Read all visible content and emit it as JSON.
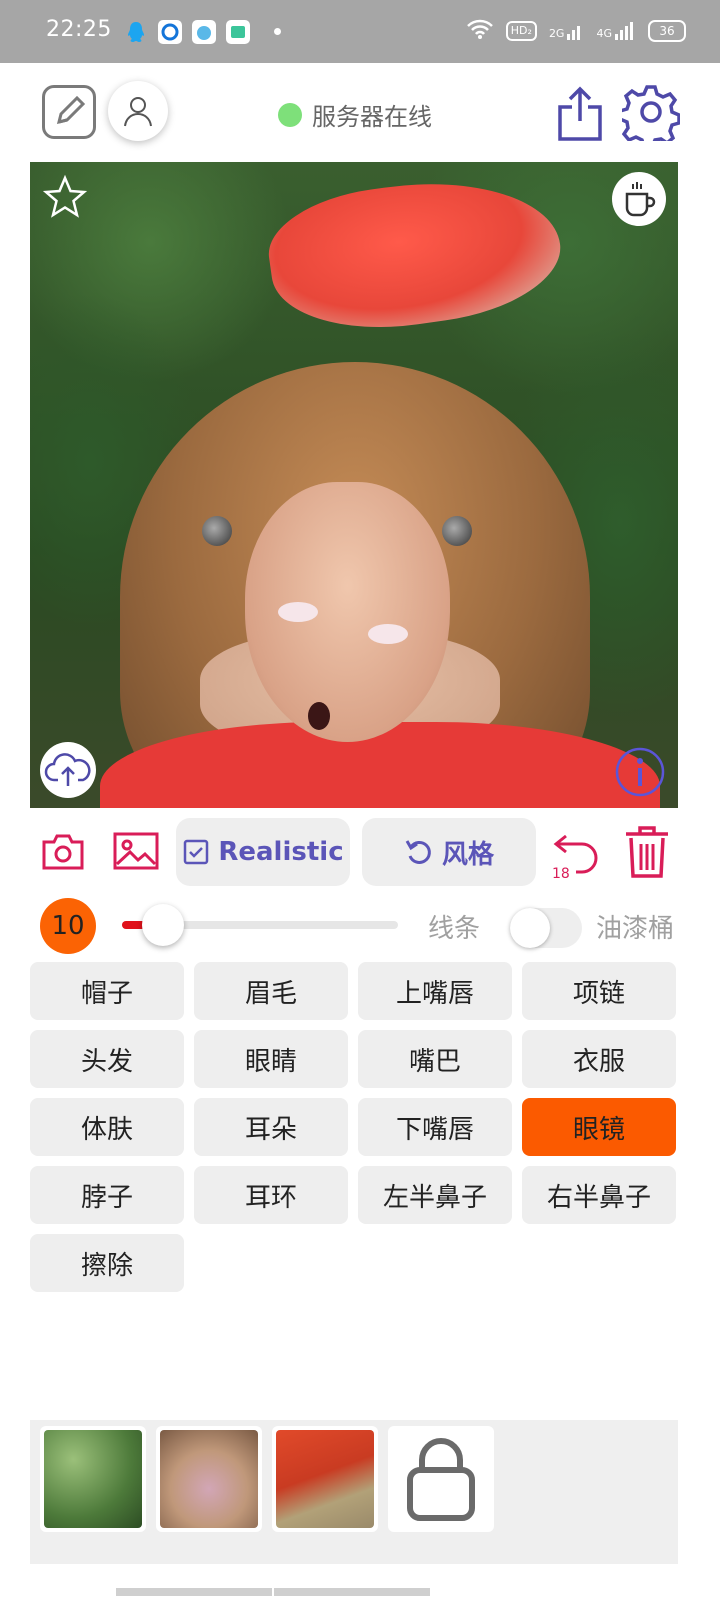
{
  "status_bar": {
    "time": "22:25",
    "hd_label": "HD₂",
    "signal_2g": "2G",
    "signal_4g": "4G",
    "battery": "36"
  },
  "header": {
    "server_status": "服务器在线",
    "server_status_color": "#7ee07a"
  },
  "toolbar": {
    "mode_label": "Realistic",
    "style_label": "风格",
    "undo_count": "18"
  },
  "brush": {
    "size": "10",
    "slider_level": 0.15,
    "line_label": "线条",
    "bucket_label": "油漆桶",
    "bucket_enabled": false
  },
  "parts": [
    {
      "label": "帽子",
      "active": false
    },
    {
      "label": "眉毛",
      "active": false
    },
    {
      "label": "上嘴唇",
      "active": false
    },
    {
      "label": "项链",
      "active": false
    },
    {
      "label": "头发",
      "active": false
    },
    {
      "label": "眼睛",
      "active": false
    },
    {
      "label": "嘴巴",
      "active": false
    },
    {
      "label": "衣服",
      "active": false
    },
    {
      "label": "体肤",
      "active": false
    },
    {
      "label": "耳朵",
      "active": false
    },
    {
      "label": "下嘴唇",
      "active": false
    },
    {
      "label": "眼镜",
      "active": true
    },
    {
      "label": "脖子",
      "active": false
    },
    {
      "label": "耳环",
      "active": false
    },
    {
      "label": "左半鼻子",
      "active": false
    },
    {
      "label": "右半鼻子",
      "active": false
    },
    {
      "label": "擦除",
      "active": false
    }
  ],
  "colors": {
    "accent": "#5b55b8",
    "danger": "#d91d58",
    "active_part": "#fb5a00"
  },
  "icons": [
    "edit-icon",
    "user-icon",
    "share-icon",
    "settings-icon",
    "star-icon",
    "cup-icon",
    "upload-cloud-icon",
    "info-icon",
    "camera-icon",
    "gallery-icon",
    "checkbox-icon",
    "refresh-icon",
    "undo-icon",
    "trash-icon",
    "bag-icon"
  ]
}
